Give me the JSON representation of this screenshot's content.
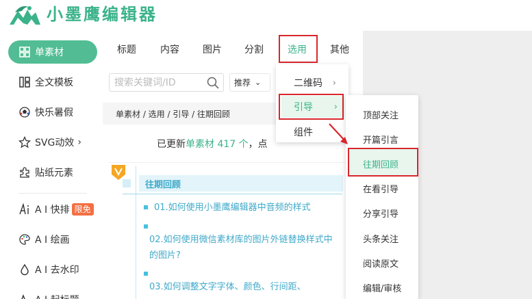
{
  "brand": {
    "name": "小墨鹰编辑器",
    "color": "#3bb38a"
  },
  "sidebar": {
    "items": [
      {
        "label": "单素材",
        "icon": "grid-icon",
        "active": true
      },
      {
        "label": "全文模板",
        "icon": "template-icon"
      },
      {
        "label": "快乐暑假",
        "icon": "soccer-ball-icon"
      },
      {
        "label": "SVG动效",
        "icon": "star-icon",
        "suffix": "›"
      },
      {
        "label": "贴纸元素",
        "icon": "puzzle-icon"
      },
      {
        "label": "A I 快排",
        "icon": "ai-icon",
        "badge": "限免"
      },
      {
        "label": "A I 绘画",
        "icon": "palette-icon"
      },
      {
        "label": "A I 去水印",
        "icon": "drop-icon"
      },
      {
        "label": "A I 起标题",
        "icon": "ai-title-icon"
      }
    ]
  },
  "tabs": [
    "标题",
    "内容",
    "图片",
    "分割",
    "选用",
    "其他"
  ],
  "search": {
    "placeholder": "搜索关键词/ID"
  },
  "sort": {
    "label": "推荐"
  },
  "breadcrumb": "单素材 / 选用 / 引导 / 往期回顾",
  "update": {
    "prefix": "已更新",
    "highlight": "单素材 417 个",
    "suffix": "，点"
  },
  "preview": {
    "section_title": "往期回顾",
    "articles": [
      "01.如何使用小墨鹰编辑器中音频的样式",
      "02.如何使用微信素材库的图片外链替换样式中的图片?",
      "03.如何调整文字字体、颜色、行间距、"
    ]
  },
  "menu1": {
    "items": [
      {
        "label": "二维码",
        "arrow": "›"
      },
      {
        "label": "引导",
        "arrow": "›",
        "active": true
      },
      {
        "label": "组件"
      }
    ]
  },
  "menu2": {
    "items": [
      "顶部关注",
      "开篇引言",
      "往期回顾",
      "在看引导",
      "分享引导",
      "头条关注",
      "阅读原文",
      "编辑/审核"
    ],
    "active": "往期回顾"
  },
  "colors": {
    "accent": "#3bb38a",
    "highlight_box": "#d9262c",
    "preview_blue": "#3fa9c9",
    "badge": "#f36f43"
  }
}
